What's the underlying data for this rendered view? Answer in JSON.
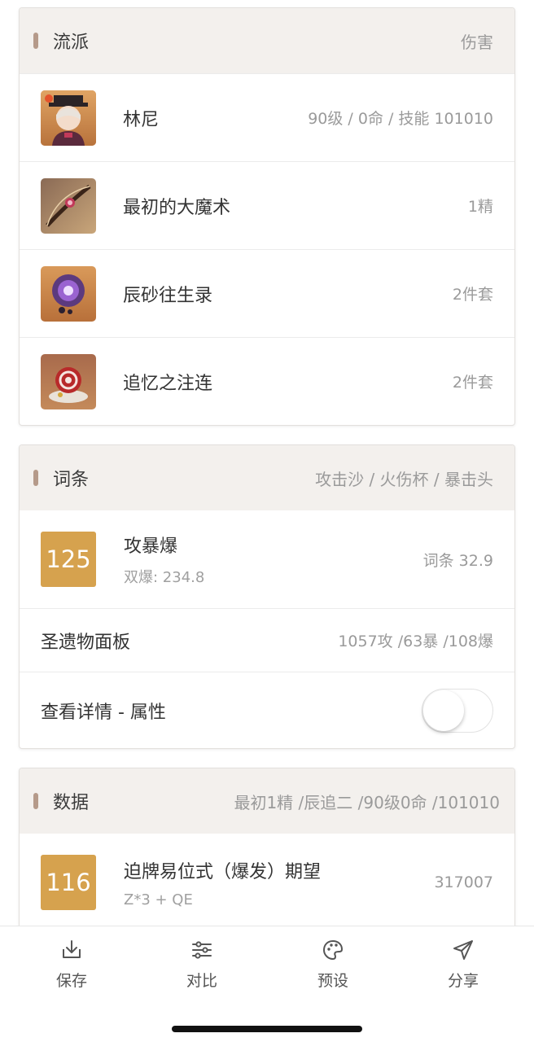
{
  "build": {
    "title": "流派",
    "extra": "伤害",
    "items": [
      {
        "name": "林尼",
        "value": "90级 / 0命 / 技能 101010",
        "icon": "character-portrait-icon"
      },
      {
        "name": "最初的大魔术",
        "value": "1精",
        "icon": "bow-weapon-icon"
      },
      {
        "name": "辰砂往生录",
        "value": "2件套",
        "icon": "artifact-flower-icon"
      },
      {
        "name": "追忆之注连",
        "value": "2件套",
        "icon": "artifact-knot-icon"
      }
    ]
  },
  "stats": {
    "title": "词条",
    "extra": "攻击沙 / 火伤杯 / 暴击头",
    "score": "125",
    "score_title": "攻暴爆",
    "score_sub": "双爆: 234.8",
    "score_value": "词条 32.9",
    "panel_label": "圣遗物面板",
    "panel_value": "1057攻 /63暴 /108爆",
    "details_label": "查看详情 - 属性",
    "details_toggle_on": false
  },
  "data": {
    "title": "数据",
    "extra": "最初1精 /辰追二 /90级0命 /101010",
    "score": "116",
    "skill_title": "迫牌易位式（爆发）期望",
    "skill_sub": "Z*3 + QE",
    "skill_value": "317007"
  },
  "tabs": [
    {
      "label": "保存",
      "icon": "download-icon"
    },
    {
      "label": "对比",
      "icon": "sliders-icon"
    },
    {
      "label": "预设",
      "icon": "palette-icon"
    },
    {
      "label": "分享",
      "icon": "send-icon"
    }
  ],
  "colors": {
    "accent_bar": "#b59a8a",
    "score_box": "#d6a24e",
    "header_bg": "#f3f0ed"
  }
}
